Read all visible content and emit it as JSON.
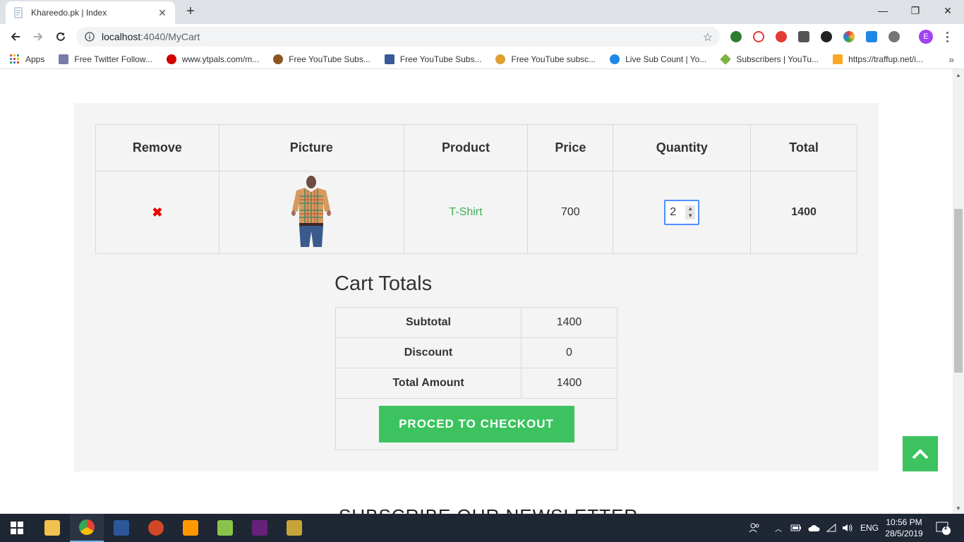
{
  "browser": {
    "tab_title": "Khareedo.pk | Index",
    "tab_close": "✕",
    "new_tab": "+",
    "url_host": "localhost",
    "url_rest": ":4040/MyCart",
    "window_controls": {
      "minimize": "—",
      "restore": "❐",
      "close": "✕"
    },
    "profile_initial": "E"
  },
  "bookmarks": [
    {
      "label": "Apps",
      "icon": "apps-grid-icon",
      "color": "#4285f4"
    },
    {
      "label": "Free Twitter Follow...",
      "icon": "bookmark-page-icon",
      "color": "#7a7aa8"
    },
    {
      "label": "www.ytpals.com/m...",
      "icon": "ytpals-icon",
      "color": "#d50000"
    },
    {
      "label": "Free YouTube Subs...",
      "icon": "mascot-icon",
      "color": "#8d5524"
    },
    {
      "label": "Free YouTube Subs...",
      "icon": "thumbs-up-icon",
      "color": "#3b5998"
    },
    {
      "label": "Free YouTube subsc...",
      "icon": "hand-icon",
      "color": "#e0a030"
    },
    {
      "label": "Live Sub Count | Yo...",
      "icon": "s-logo-icon",
      "color": "#1e88e5"
    },
    {
      "label": "Subscribers | YouTu...",
      "icon": "diamond-icon",
      "color": "#7cb342"
    },
    {
      "label": "https://traffup.net/i...",
      "icon": "house-icon",
      "color": "#f9a825"
    }
  ],
  "cart": {
    "headers": [
      "Remove",
      "Picture",
      "Product",
      "Price",
      "Quantity",
      "Total"
    ],
    "rows": [
      {
        "remove": "✖",
        "product": "T-Shirt",
        "price": "700",
        "quantity": "2",
        "total": "1400"
      }
    ]
  },
  "totals": {
    "title": "Cart Totals",
    "rows": [
      {
        "label": "Subtotal",
        "value": "1400"
      },
      {
        "label": "Discount",
        "value": "0"
      },
      {
        "label": "Total Amount",
        "value": "1400"
      }
    ],
    "checkout_label": "PROCED TO CHECKOUT"
  },
  "newsletter_title": "SUBSCRIBE OUR NEWSLETTER",
  "taskbar": {
    "language": "ENG",
    "time": "10:56 PM",
    "date": "28/5/2019",
    "notification_count": "1"
  },
  "colors": {
    "accent_green": "#3cc35f",
    "product_link": "#3fb056",
    "remove_red": "#ee0000",
    "panel_bg": "#f4f4f4"
  }
}
